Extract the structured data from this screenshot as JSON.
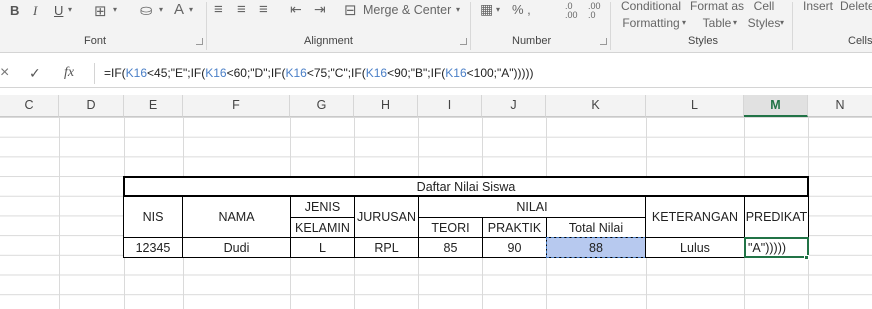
{
  "ribbon": {
    "font_group": "Font",
    "alignment_group": "Alignment",
    "number_group": "Number",
    "styles_group": "Styles",
    "cells_group": "Cells",
    "bold": "B",
    "italic": "I",
    "underline": "U",
    "merge_center": "Merge & Center",
    "number_format": "% ,",
    "conditional_formatting_line1": "Conditional",
    "conditional_formatting_line2": "Formatting",
    "format_as_table_line1": "Format as",
    "format_as_table_line2": "Table",
    "cell_styles_line1": "Cell",
    "cell_styles_line2": "Styles",
    "insert": "Insert",
    "delete": "Delete"
  },
  "formula_bar": {
    "cancel": "×",
    "enter": "✓",
    "fx": "fx",
    "formula_parts": [
      "=IF(",
      "K16",
      "<45;\"E\";IF(",
      "K16",
      "<60;\"D\";IF(",
      "K16",
      "<75;\"C\";IF(",
      "K16",
      "<90;\"B\";IF(",
      "K16",
      "<100;\"A\")))))"
    ]
  },
  "columns": [
    "C",
    "D",
    "E",
    "F",
    "G",
    "H",
    "I",
    "J",
    "K",
    "L",
    "M",
    "N"
  ],
  "selected_column": "M",
  "table": {
    "title": "Daftar Nilai Siswa",
    "headers": {
      "nis": "NIS",
      "nama": "NAMA",
      "jenis_kelamin_1": "JENIS",
      "jenis_kelamin_2": "KELAMIN",
      "jurusan": "JURUSAN",
      "nilai": "NILAI",
      "teori": "TEORI",
      "praktik": "PRAKTIK",
      "total_nilai": "Total Nilai",
      "keterangan": "KETERANGAN",
      "predikat": "PREDIKAT"
    },
    "row": {
      "nis": "12345",
      "nama": "Dudi",
      "jenis_kelamin": "L",
      "jurusan": "RPL",
      "teori": "85",
      "praktik": "90",
      "total_nilai": "88",
      "keterangan": "Lulus",
      "predikat": "\"A\")))))"
    }
  },
  "colors": {
    "excel_green": "#217346",
    "ref_blue": "#4a7fc7",
    "selection_fill": "#b7c9ef"
  }
}
